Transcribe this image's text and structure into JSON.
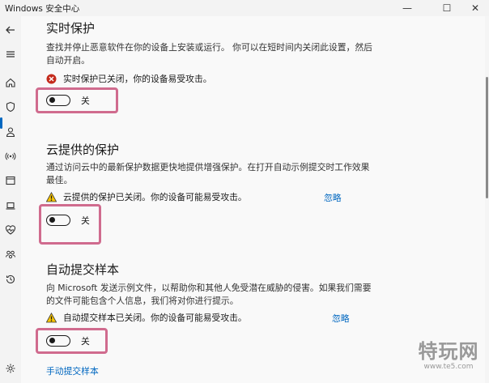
{
  "window": {
    "title": "Windows 安全中心",
    "minimize": "—",
    "maximize": "☐",
    "close": "✕"
  },
  "sections": [
    {
      "title": "实时保护",
      "description": "查找并停止恶意软件在你的设备上安装或运行。 你可以在短时间内关闭此设置，然后自动开启。",
      "status_text": "实时保护已关闭，你的设备易受攻击。",
      "status_icon": "error-icon",
      "toggle_label": "关",
      "toggle_state": "off"
    },
    {
      "title": "云提供的保护",
      "description": "通过访问云中的最新保护数据更快地提供增强保护。在打开自动示例提交时工作效果最佳。",
      "status_text": "云提供的保护已关闭。你的设备可能易受攻击。",
      "status_icon": "warning-icon",
      "ignore_label": "忽略",
      "toggle_label": "关",
      "toggle_state": "off"
    },
    {
      "title": "自动提交样本",
      "description": "向 Microsoft 发送示例文件，以帮助你和其他人免受潜在威胁的侵害。如果我们需要的文件可能包含个人信息，我们将对你进行提示。",
      "status_text": "自动提交样本已关闭。你的设备可能易受攻击。",
      "status_icon": "warning-icon",
      "ignore_label": "忽略",
      "toggle_label": "关",
      "toggle_state": "off"
    }
  ],
  "manual_submit_link": "手动提交样本",
  "watermark": {
    "main": "特玩网",
    "sub": "www.te5.com"
  },
  "colors": {
    "accent": "#0067c0",
    "error": "#c42b1c",
    "warning": "#f7c400",
    "highlight": "#d06b8e"
  }
}
